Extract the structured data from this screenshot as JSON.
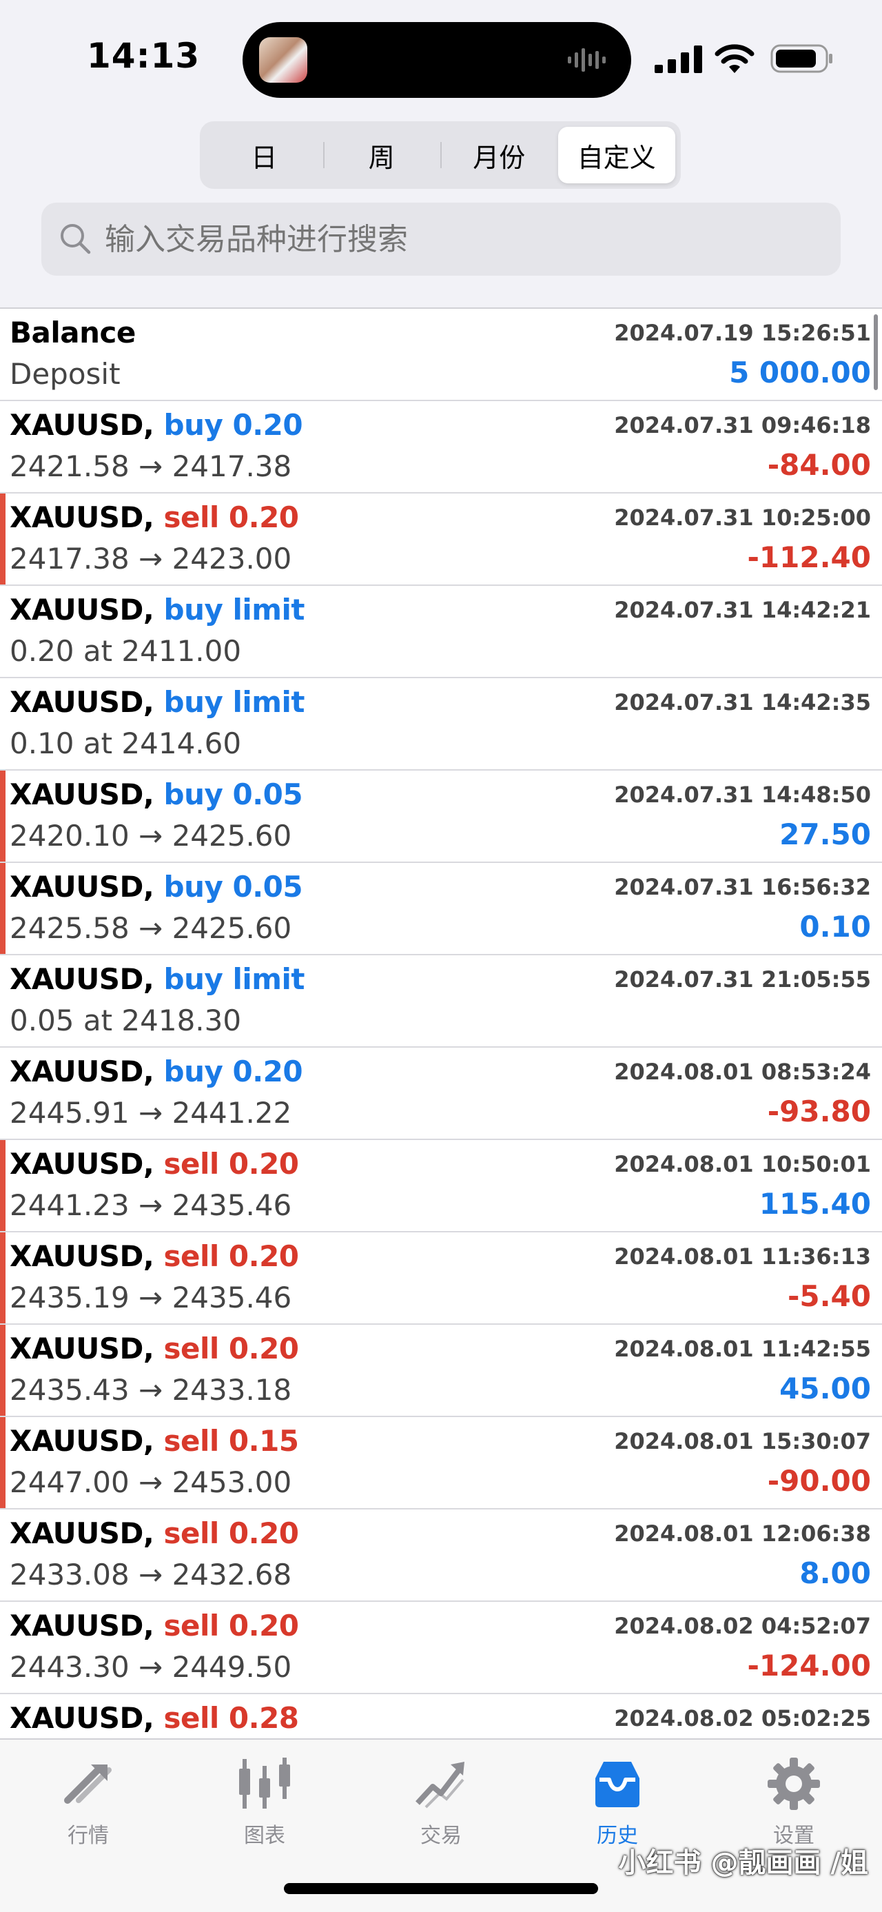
{
  "status": {
    "time": "14:13"
  },
  "periods": [
    "日",
    "周",
    "月份",
    "自定义"
  ],
  "search": {
    "placeholder": "输入交易品种进行搜索"
  },
  "rows": [
    {
      "symbol": "Balance",
      "direction": "",
      "dir_class": "neutral",
      "time": "2024.07.19 15:26:51",
      "detail": "Deposit",
      "profit": "5 000.00",
      "profit_class": "pos",
      "marked": false
    },
    {
      "symbol": "XAUUSD,",
      "direction": "buy 0.20",
      "dir_class": "buy",
      "time": "2024.07.31 09:46:18",
      "detail": "2421.58 → 2417.38",
      "profit": "-84.00",
      "profit_class": "neg",
      "marked": false
    },
    {
      "symbol": "XAUUSD,",
      "direction": "sell 0.20",
      "dir_class": "sell",
      "time": "2024.07.31 10:25:00",
      "detail": "2417.38 → 2423.00",
      "profit": "-112.40",
      "profit_class": "neg",
      "marked": true
    },
    {
      "symbol": "XAUUSD,",
      "direction": "buy limit",
      "dir_class": "buy",
      "time": "2024.07.31 14:42:21",
      "detail": "0.20 at 2411.00",
      "profit": "",
      "profit_class": "pos",
      "marked": false
    },
    {
      "symbol": "XAUUSD,",
      "direction": "buy limit",
      "dir_class": "buy",
      "time": "2024.07.31 14:42:35",
      "detail": "0.10 at 2414.60",
      "profit": "",
      "profit_class": "pos",
      "marked": false
    },
    {
      "symbol": "XAUUSD,",
      "direction": "buy 0.05",
      "dir_class": "buy",
      "time": "2024.07.31 14:48:50",
      "detail": "2420.10 → 2425.60",
      "profit": "27.50",
      "profit_class": "pos",
      "marked": true
    },
    {
      "symbol": "XAUUSD,",
      "direction": "buy 0.05",
      "dir_class": "buy",
      "time": "2024.07.31 16:56:32",
      "detail": "2425.58 → 2425.60",
      "profit": "0.10",
      "profit_class": "pos",
      "marked": true
    },
    {
      "symbol": "XAUUSD,",
      "direction": "buy limit",
      "dir_class": "buy",
      "time": "2024.07.31 21:05:55",
      "detail": "0.05 at 2418.30",
      "profit": "",
      "profit_class": "pos",
      "marked": false
    },
    {
      "symbol": "XAUUSD,",
      "direction": "buy 0.20",
      "dir_class": "buy",
      "time": "2024.08.01 08:53:24",
      "detail": "2445.91 → 2441.22",
      "profit": "-93.80",
      "profit_class": "neg",
      "marked": false
    },
    {
      "symbol": "XAUUSD,",
      "direction": "sell 0.20",
      "dir_class": "sell",
      "time": "2024.08.01 10:50:01",
      "detail": "2441.23 → 2435.46",
      "profit": "115.40",
      "profit_class": "pos",
      "marked": true
    },
    {
      "symbol": "XAUUSD,",
      "direction": "sell 0.20",
      "dir_class": "sell",
      "time": "2024.08.01 11:36:13",
      "detail": "2435.19 → 2435.46",
      "profit": "-5.40",
      "profit_class": "neg",
      "marked": true
    },
    {
      "symbol": "XAUUSD,",
      "direction": "sell 0.20",
      "dir_class": "sell",
      "time": "2024.08.01 11:42:55",
      "detail": "2435.43 → 2433.18",
      "profit": "45.00",
      "profit_class": "pos",
      "marked": true
    },
    {
      "symbol": "XAUUSD,",
      "direction": "sell 0.15",
      "dir_class": "sell",
      "time": "2024.08.01 15:30:07",
      "detail": "2447.00 → 2453.00",
      "profit": "-90.00",
      "profit_class": "neg",
      "marked": true
    },
    {
      "symbol": "XAUUSD,",
      "direction": "sell 0.20",
      "dir_class": "sell",
      "time": "2024.08.01 12:06:38",
      "detail": "2433.08 → 2432.68",
      "profit": "8.00",
      "profit_class": "pos",
      "marked": false
    },
    {
      "symbol": "XAUUSD,",
      "direction": "sell 0.20",
      "dir_class": "sell",
      "time": "2024.08.02 04:52:07",
      "detail": "2443.30 → 2449.50",
      "profit": "-124.00",
      "profit_class": "neg",
      "marked": false
    },
    {
      "symbol": "XAUUSD,",
      "direction": "sell 0.28",
      "dir_class": "sell",
      "time": "2024.08.02 05:02:25",
      "detail": "",
      "profit": "",
      "profit_class": "neg",
      "marked": false
    }
  ],
  "tabs": [
    {
      "label": "行情",
      "icon": "quotes-icon",
      "active": false
    },
    {
      "label": "图表",
      "icon": "chart-icon",
      "active": false
    },
    {
      "label": "交易",
      "icon": "trade-icon",
      "active": false
    },
    {
      "label": "历史",
      "icon": "history-icon",
      "active": true
    },
    {
      "label": "设置",
      "icon": "settings-icon",
      "active": false
    }
  ],
  "watermark": "小红书 @靓画画 /姐",
  "colors": {
    "buy": "#1a7ae6",
    "sell": "#d8392b",
    "marker": "#e0503e",
    "tab_active": "#1a7ae6",
    "tab_inactive": "#8e8e93"
  }
}
